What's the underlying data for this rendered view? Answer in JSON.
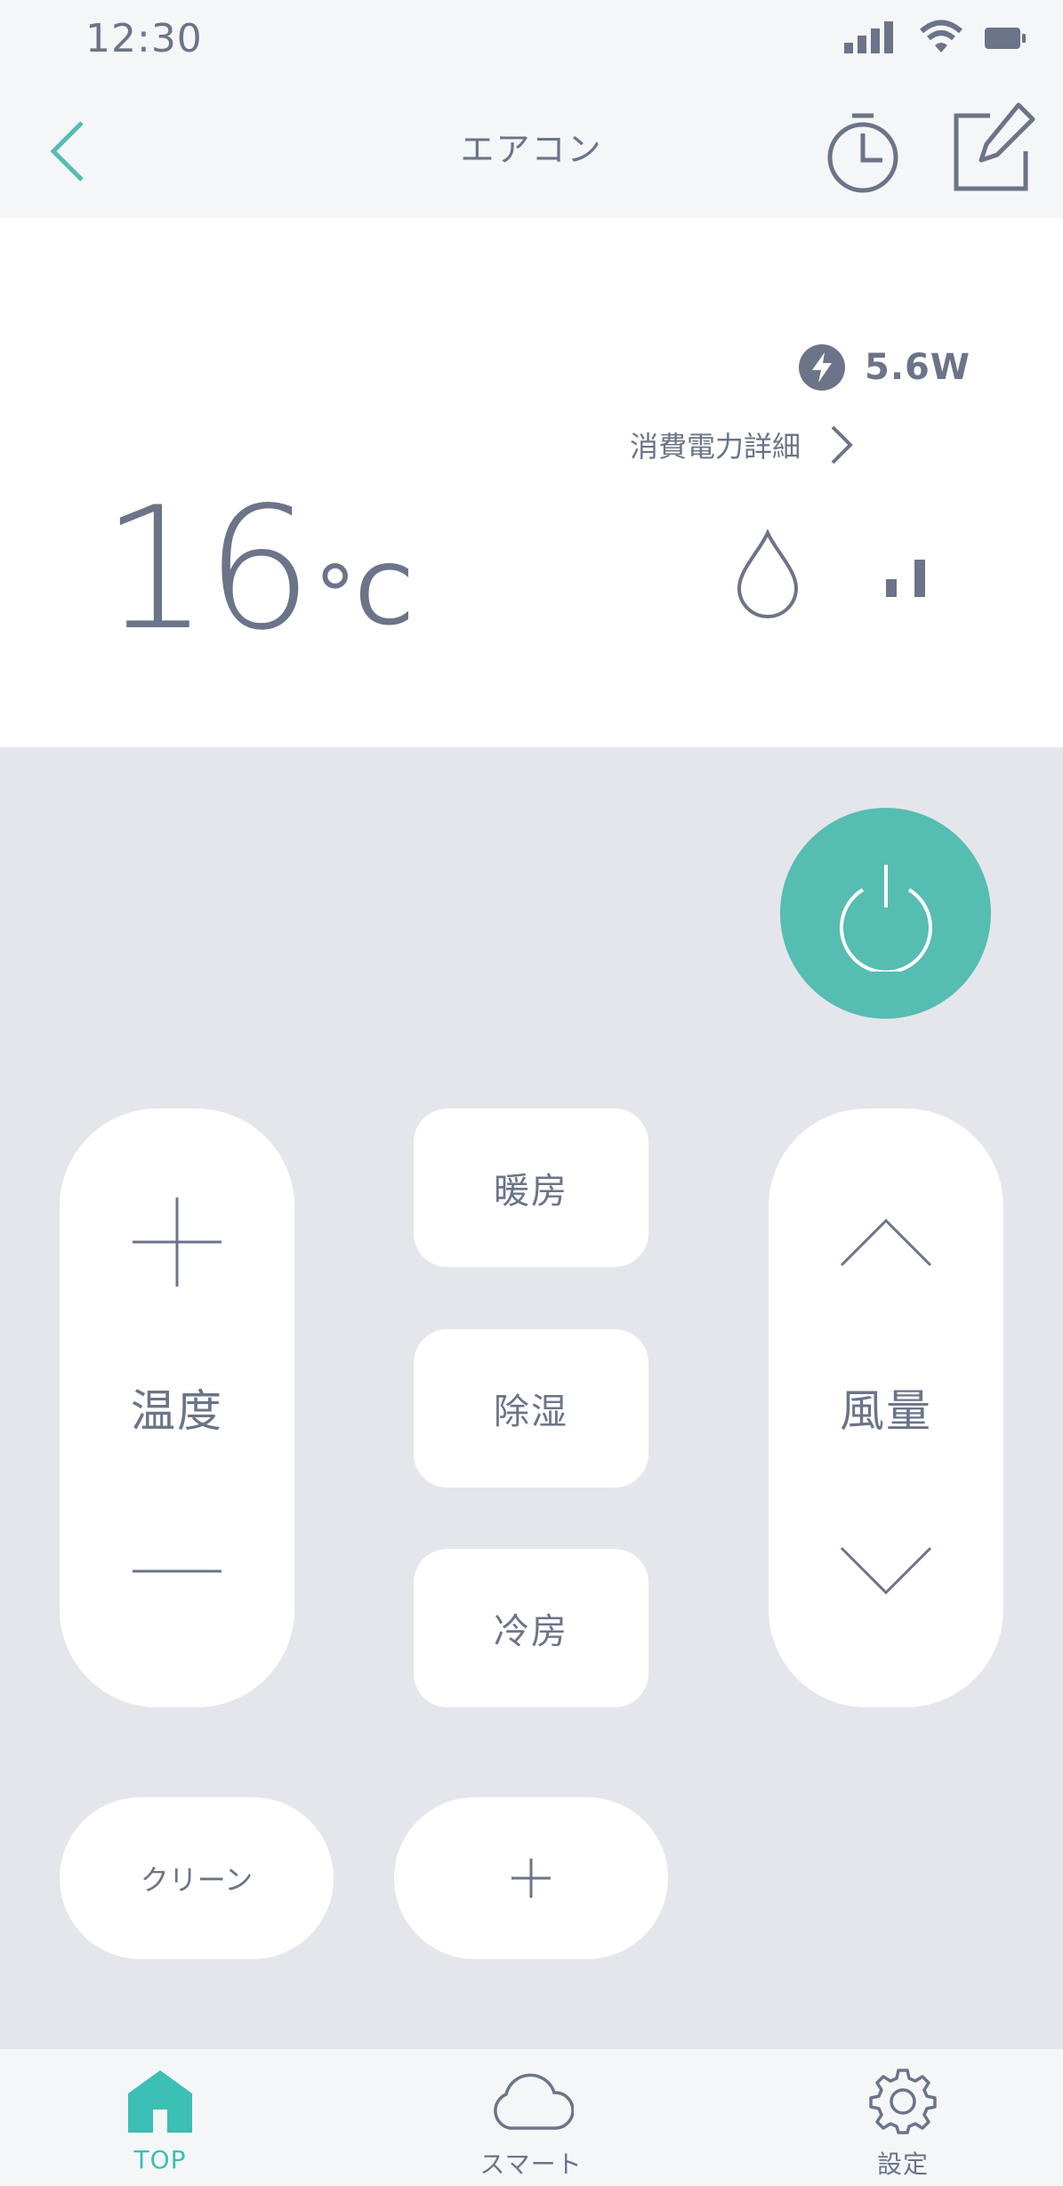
{
  "status_bar": {
    "time": "12:30"
  },
  "header": {
    "title": "エアコン"
  },
  "info": {
    "power_value": "5.6W",
    "power_detail_label": "消費電力詳細",
    "temperature": "16",
    "temperature_unit": "°C",
    "mode_icon": "water-drop-icon",
    "fan_level_icon": "signal-bars-icon"
  },
  "controls": {
    "temp_label": "温度",
    "fan_label": "風量",
    "modes": [
      "暖房",
      "除湿",
      "冷房"
    ],
    "clean_label": "クリーン",
    "add_label": "+"
  },
  "tabs": [
    {
      "label": "TOP",
      "icon": "home-icon",
      "active": true
    },
    {
      "label": "スマート",
      "icon": "cloud-icon",
      "active": false
    },
    {
      "label": "設定",
      "icon": "gear-icon",
      "active": false
    }
  ],
  "colors": {
    "accent": "#56bdb2",
    "text": "#6b7488",
    "background": "#e4e6eb",
    "panel": "#ffffff"
  }
}
